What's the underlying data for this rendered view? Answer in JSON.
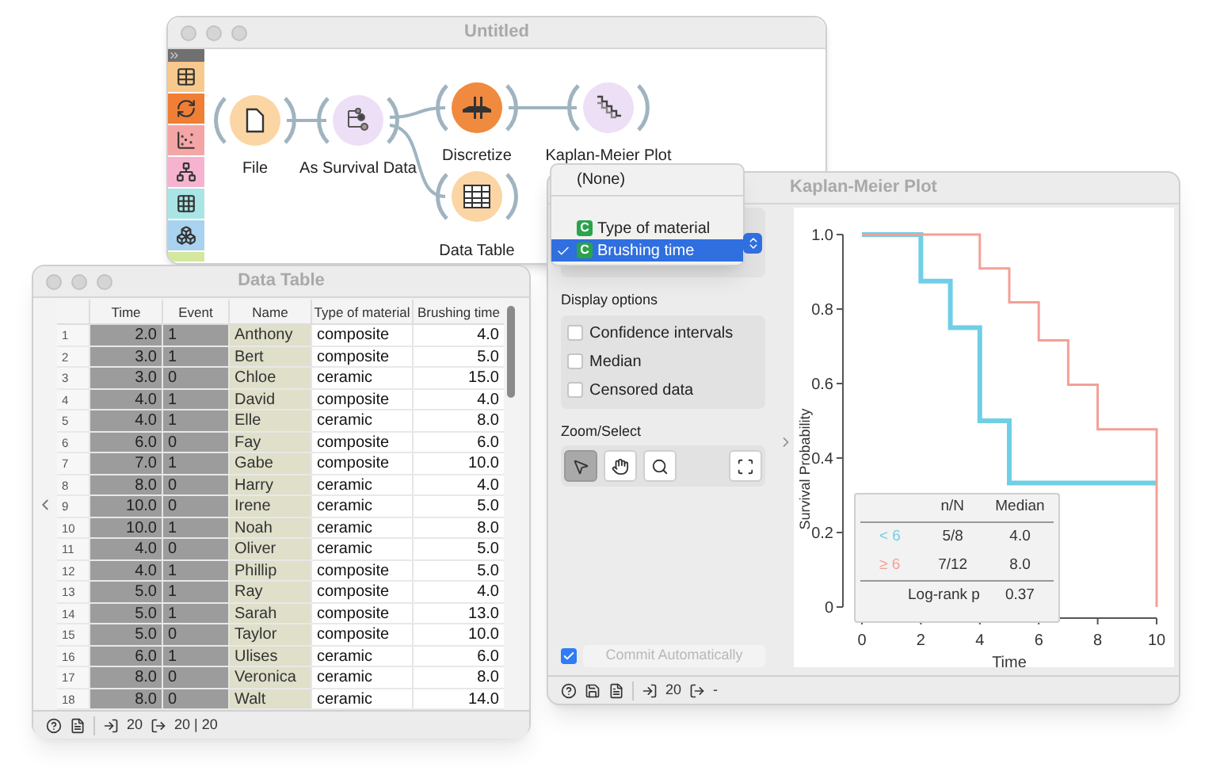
{
  "workflow": {
    "title": "Untitled",
    "toolbox": [
      {
        "color": "#f8c98c"
      },
      {
        "color": "#f07f35"
      },
      {
        "color": "#f4a6a6"
      },
      {
        "color": "#f6b3cf"
      },
      {
        "color": "#a9e5e5"
      },
      {
        "color": "#a9d2ee"
      },
      {
        "color": "#d3e79f"
      }
    ],
    "nodes": [
      {
        "label": "File",
        "color": "#fbd5a4"
      },
      {
        "label": "As Survival Data",
        "color": "#ecdff6"
      },
      {
        "label": "Discretize",
        "color": "#f08a3e"
      },
      {
        "label": "Kaplan-Meier Plot",
        "color": "#ecdff6"
      },
      {
        "label": "Data Table",
        "color": "#fbd5a4"
      }
    ]
  },
  "data_table": {
    "title": "Data Table",
    "columns": [
      "Time",
      "Event",
      "Name",
      "Type of material",
      "Brushing time"
    ],
    "rows": [
      {
        "num": "1",
        "cells": [
          "2.0",
          "1",
          "Anthony",
          "composite",
          "4.0"
        ]
      },
      {
        "num": "2",
        "cells": [
          "3.0",
          "1",
          "Bert",
          "composite",
          "5.0"
        ]
      },
      {
        "num": "3",
        "cells": [
          "3.0",
          "0",
          "Chloe",
          "ceramic",
          "15.0"
        ]
      },
      {
        "num": "4",
        "cells": [
          "4.0",
          "1",
          "David",
          "composite",
          "4.0"
        ]
      },
      {
        "num": "5",
        "cells": [
          "4.0",
          "1",
          "Elle",
          "ceramic",
          "8.0"
        ]
      },
      {
        "num": "6",
        "cells": [
          "6.0",
          "0",
          "Fay",
          "composite",
          "6.0"
        ]
      },
      {
        "num": "7",
        "cells": [
          "7.0",
          "1",
          "Gabe",
          "composite",
          "10.0"
        ]
      },
      {
        "num": "8",
        "cells": [
          "8.0",
          "0",
          "Harry",
          "ceramic",
          "4.0"
        ]
      },
      {
        "num": "9",
        "cells": [
          "10.0",
          "0",
          "Irene",
          "ceramic",
          "5.0"
        ]
      },
      {
        "num": "10",
        "cells": [
          "10.0",
          "1",
          "Noah",
          "ceramic",
          "8.0"
        ]
      },
      {
        "num": "11",
        "cells": [
          "4.0",
          "0",
          "Oliver",
          "ceramic",
          "5.0"
        ]
      },
      {
        "num": "12",
        "cells": [
          "4.0",
          "1",
          "Phillip",
          "composite",
          "5.0"
        ]
      },
      {
        "num": "13",
        "cells": [
          "5.0",
          "1",
          "Ray",
          "composite",
          "4.0"
        ]
      },
      {
        "num": "14",
        "cells": [
          "5.0",
          "1",
          "Sarah",
          "composite",
          "13.0"
        ]
      },
      {
        "num": "15",
        "cells": [
          "5.0",
          "0",
          "Taylor",
          "composite",
          "10.0"
        ]
      },
      {
        "num": "16",
        "cells": [
          "6.0",
          "1",
          "Ulises",
          "ceramic",
          "6.0"
        ]
      },
      {
        "num": "17",
        "cells": [
          "8.0",
          "0",
          "Veronica",
          "ceramic",
          "8.0"
        ]
      },
      {
        "num": "18",
        "cells": [
          "8.0",
          "0",
          "Walt",
          "ceramic",
          "14.0"
        ]
      }
    ],
    "status": {
      "input": "20",
      "output": "20 | 20"
    }
  },
  "km_window": {
    "title": "Kaplan-Meier Plot",
    "dropdown": {
      "items": [
        {
          "label": "(None)",
          "selected": false
        },
        {
          "label": "Type of material",
          "badge": "C",
          "selected": false
        },
        {
          "label": "Brushing time",
          "badge": "C",
          "selected": true
        }
      ]
    },
    "display_options": {
      "label": "Display options",
      "options": [
        {
          "label": "Confidence intervals",
          "checked": false
        },
        {
          "label": "Median",
          "checked": false
        },
        {
          "label": "Censored data",
          "checked": false
        }
      ]
    },
    "zoom_select": {
      "label": "Zoom/Select",
      "tools": [
        {
          "selected": true
        },
        {
          "selected": false
        },
        {
          "selected": false
        },
        {
          "selected": false
        }
      ]
    },
    "commit": {
      "label": "Commit Automatically",
      "checked": true,
      "disabled": true
    },
    "chart_data": {
      "type": "line",
      "xlabel": "Time",
      "ylabel": "Survival Probability",
      "x": [
        0,
        2,
        2,
        3,
        3,
        4,
        4,
        5,
        5,
        6,
        6,
        7,
        7,
        8,
        8,
        10,
        10
      ],
      "xlim": [
        0,
        10
      ],
      "ylim": [
        0,
        1
      ],
      "xticks": [
        0,
        2,
        4,
        6,
        8,
        10
      ],
      "yticks": [
        {
          "value": 0,
          "label": "0"
        },
        {
          "value": 0.2,
          "label": "0.2"
        },
        {
          "value": 0.4,
          "label": "0.4"
        },
        {
          "value": 0.6,
          "label": "0.6"
        },
        {
          "value": 0.8,
          "label": "0.8"
        },
        {
          "value": 1,
          "label": "1.0"
        }
      ],
      "series": [
        {
          "name": "< 6",
          "color": "#6fcfe6",
          "values": [
            1,
            1,
            0.875,
            0.875,
            0.75,
            0.75,
            0.5,
            0.5,
            0.333,
            0.333,
            0.333,
            0.333,
            0.333,
            0.333,
            0.333,
            0.333,
            0.333
          ]
        },
        {
          "name": "≥ 6",
          "color": "#f3a096",
          "values": [
            1,
            1,
            1,
            1,
            1,
            1,
            0.909,
            0.909,
            0.818,
            0.818,
            0.716,
            0.716,
            0.597,
            0.597,
            0.477,
            0.477,
            0
          ]
        }
      ]
    },
    "stats": {
      "columns": [
        "n/N",
        "Median"
      ],
      "rows": [
        {
          "n": "5/8",
          "median": "4.0"
        },
        {
          "n": "7/12",
          "median": "8.0"
        }
      ],
      "test_label": "Log-rank p",
      "test_value": "0.37"
    },
    "status": {
      "input": "20",
      "output": "-"
    }
  }
}
